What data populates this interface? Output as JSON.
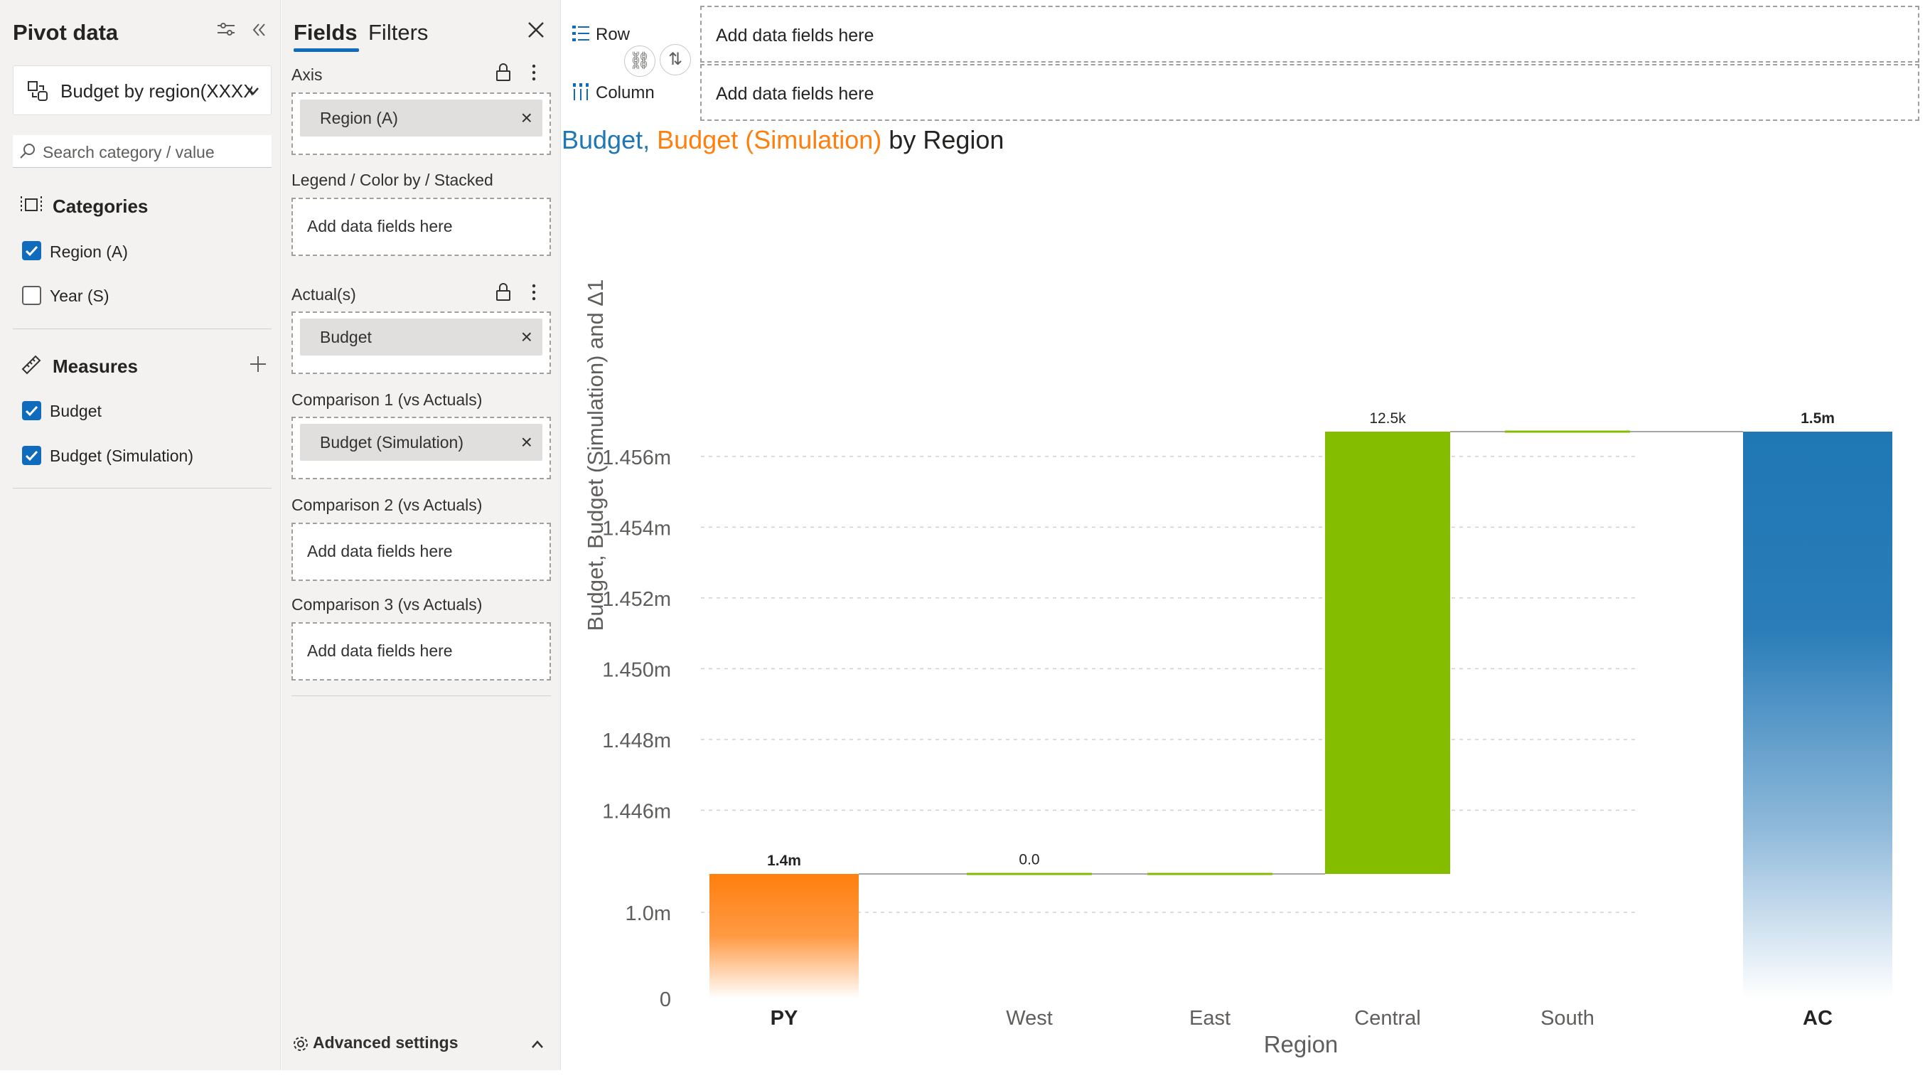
{
  "pivot": {
    "title": "Pivot data",
    "selected_view": "Budget by region(XXXX)",
    "search_placeholder": "Search category / value",
    "categories_title": "Categories",
    "categories": [
      {
        "label": "Region (A)",
        "checked": true
      },
      {
        "label": "Year (S)",
        "checked": false
      }
    ],
    "measures_title": "Measures",
    "measures": [
      {
        "label": "Budget",
        "checked": true
      },
      {
        "label": "Budget (Simulation)",
        "checked": true
      }
    ]
  },
  "fields": {
    "tabs": [
      "Fields",
      "Filters"
    ],
    "active_tab": "Fields",
    "axis_label": "Axis",
    "axis_value": "Region (A)",
    "legend_label": "Legend / Color by / Stacked",
    "legend_hint": "Add data fields here",
    "actuals_label": "Actual(s)",
    "actuals_value": "Budget",
    "comp1_label": "Comparison 1 (vs Actuals)",
    "comp1_value": "Budget (Simulation)",
    "comp2_label": "Comparison 2 (vs Actuals)",
    "comp2_hint": "Add data fields here",
    "comp3_label": "Comparison 3 (vs Actuals)",
    "comp3_hint": "Add data fields here",
    "advanced_label": "Advanced settings"
  },
  "visual": {
    "row_label": "Row",
    "column_label": "Column",
    "row_hint": "Add data fields here",
    "column_hint": "Add data fields here",
    "title_part1": "Budget",
    "title_sep": ", ",
    "title_part2": "Budget (Simulation)",
    "title_part3": " by Region"
  },
  "colors": {
    "actual_blue": "#1f77b4",
    "previous_orange": "#ff7f0e",
    "positive_green": "#84bc00",
    "accent": "#0f6cbd",
    "title_blue": "#1f77b4",
    "title_orange": "#ff7f0e"
  },
  "chart_data": {
    "type": "bar",
    "subtype": "waterfall",
    "title": "Budget, Budget (Simulation) by Region",
    "xlabel": "Region",
    "ylabel": "Budget, Budget (Simulation) and Δ1",
    "categories": [
      "PY",
      "West",
      "East",
      "Central",
      "South",
      "AC"
    ],
    "bars": [
      {
        "category": "PY",
        "kind": "total",
        "value": 1444200,
        "label": "1.4m",
        "label_bold": true
      },
      {
        "category": "West",
        "kind": "delta",
        "value": 0,
        "label": "0.0",
        "label_bold": false
      },
      {
        "category": "East",
        "kind": "delta",
        "value": 0,
        "label": "",
        "label_bold": false
      },
      {
        "category": "Central",
        "kind": "delta",
        "value": 12500,
        "label": "12.5k",
        "label_bold": false
      },
      {
        "category": "South",
        "kind": "delta",
        "value": 0,
        "label": "",
        "label_bold": false
      },
      {
        "category": "AC",
        "kind": "total",
        "value": 1456700,
        "label": "1.5m",
        "label_bold": true
      }
    ],
    "y_ticks": [
      {
        "value": 0,
        "label": "0"
      },
      {
        "value": 1000000,
        "label": "1.0m"
      },
      {
        "value": 1446000,
        "label": "1.446m"
      },
      {
        "value": 1448000,
        "label": "1.448m"
      },
      {
        "value": 1450000,
        "label": "1.450m"
      },
      {
        "value": 1452000,
        "label": "1.452m"
      },
      {
        "value": 1454000,
        "label": "1.454m"
      },
      {
        "value": 1456000,
        "label": "1.456m"
      }
    ],
    "axis_break": true,
    "grid": true,
    "legend": "none"
  }
}
